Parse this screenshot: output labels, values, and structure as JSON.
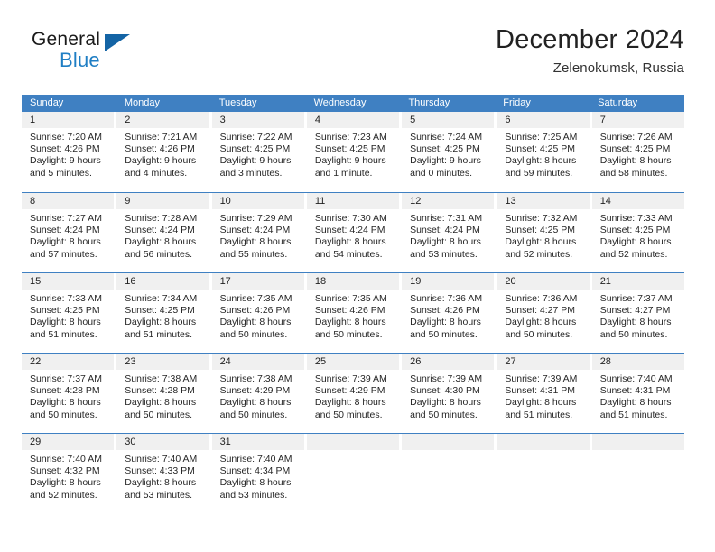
{
  "brand": {
    "name_part1": "General",
    "name_part2": "Blue",
    "triangle_icon": "triangle-icon",
    "accent_blue": "#1f7ec4",
    "logo_blue": "#1464a5"
  },
  "header": {
    "title": "December 2024",
    "subtitle": "Zelenokumsk, Russia"
  },
  "theme": {
    "header_row_bg": "#3f80c2",
    "day_number_bg": "#f0f0f0",
    "week_border": "#3f80c2",
    "text": "#262626"
  },
  "weekday_headers": [
    "Sunday",
    "Monday",
    "Tuesday",
    "Wednesday",
    "Thursday",
    "Friday",
    "Saturday"
  ],
  "weeks": [
    [
      {
        "day": "1",
        "sunrise": "Sunrise: 7:20 AM",
        "sunset": "Sunset: 4:26 PM",
        "daylight_line1": "Daylight: 9 hours",
        "daylight_line2": "and 5 minutes."
      },
      {
        "day": "2",
        "sunrise": "Sunrise: 7:21 AM",
        "sunset": "Sunset: 4:26 PM",
        "daylight_line1": "Daylight: 9 hours",
        "daylight_line2": "and 4 minutes."
      },
      {
        "day": "3",
        "sunrise": "Sunrise: 7:22 AM",
        "sunset": "Sunset: 4:25 PM",
        "daylight_line1": "Daylight: 9 hours",
        "daylight_line2": "and 3 minutes."
      },
      {
        "day": "4",
        "sunrise": "Sunrise: 7:23 AM",
        "sunset": "Sunset: 4:25 PM",
        "daylight_line1": "Daylight: 9 hours",
        "daylight_line2": "and 1 minute."
      },
      {
        "day": "5",
        "sunrise": "Sunrise: 7:24 AM",
        "sunset": "Sunset: 4:25 PM",
        "daylight_line1": "Daylight: 9 hours",
        "daylight_line2": "and 0 minutes."
      },
      {
        "day": "6",
        "sunrise": "Sunrise: 7:25 AM",
        "sunset": "Sunset: 4:25 PM",
        "daylight_line1": "Daylight: 8 hours",
        "daylight_line2": "and 59 minutes."
      },
      {
        "day": "7",
        "sunrise": "Sunrise: 7:26 AM",
        "sunset": "Sunset: 4:25 PM",
        "daylight_line1": "Daylight: 8 hours",
        "daylight_line2": "and 58 minutes."
      }
    ],
    [
      {
        "day": "8",
        "sunrise": "Sunrise: 7:27 AM",
        "sunset": "Sunset: 4:24 PM",
        "daylight_line1": "Daylight: 8 hours",
        "daylight_line2": "and 57 minutes."
      },
      {
        "day": "9",
        "sunrise": "Sunrise: 7:28 AM",
        "sunset": "Sunset: 4:24 PM",
        "daylight_line1": "Daylight: 8 hours",
        "daylight_line2": "and 56 minutes."
      },
      {
        "day": "10",
        "sunrise": "Sunrise: 7:29 AM",
        "sunset": "Sunset: 4:24 PM",
        "daylight_line1": "Daylight: 8 hours",
        "daylight_line2": "and 55 minutes."
      },
      {
        "day": "11",
        "sunrise": "Sunrise: 7:30 AM",
        "sunset": "Sunset: 4:24 PM",
        "daylight_line1": "Daylight: 8 hours",
        "daylight_line2": "and 54 minutes."
      },
      {
        "day": "12",
        "sunrise": "Sunrise: 7:31 AM",
        "sunset": "Sunset: 4:24 PM",
        "daylight_line1": "Daylight: 8 hours",
        "daylight_line2": "and 53 minutes."
      },
      {
        "day": "13",
        "sunrise": "Sunrise: 7:32 AM",
        "sunset": "Sunset: 4:25 PM",
        "daylight_line1": "Daylight: 8 hours",
        "daylight_line2": "and 52 minutes."
      },
      {
        "day": "14",
        "sunrise": "Sunrise: 7:33 AM",
        "sunset": "Sunset: 4:25 PM",
        "daylight_line1": "Daylight: 8 hours",
        "daylight_line2": "and 52 minutes."
      }
    ],
    [
      {
        "day": "15",
        "sunrise": "Sunrise: 7:33 AM",
        "sunset": "Sunset: 4:25 PM",
        "daylight_line1": "Daylight: 8 hours",
        "daylight_line2": "and 51 minutes."
      },
      {
        "day": "16",
        "sunrise": "Sunrise: 7:34 AM",
        "sunset": "Sunset: 4:25 PM",
        "daylight_line1": "Daylight: 8 hours",
        "daylight_line2": "and 51 minutes."
      },
      {
        "day": "17",
        "sunrise": "Sunrise: 7:35 AM",
        "sunset": "Sunset: 4:26 PM",
        "daylight_line1": "Daylight: 8 hours",
        "daylight_line2": "and 50 minutes."
      },
      {
        "day": "18",
        "sunrise": "Sunrise: 7:35 AM",
        "sunset": "Sunset: 4:26 PM",
        "daylight_line1": "Daylight: 8 hours",
        "daylight_line2": "and 50 minutes."
      },
      {
        "day": "19",
        "sunrise": "Sunrise: 7:36 AM",
        "sunset": "Sunset: 4:26 PM",
        "daylight_line1": "Daylight: 8 hours",
        "daylight_line2": "and 50 minutes."
      },
      {
        "day": "20",
        "sunrise": "Sunrise: 7:36 AM",
        "sunset": "Sunset: 4:27 PM",
        "daylight_line1": "Daylight: 8 hours",
        "daylight_line2": "and 50 minutes."
      },
      {
        "day": "21",
        "sunrise": "Sunrise: 7:37 AM",
        "sunset": "Sunset: 4:27 PM",
        "daylight_line1": "Daylight: 8 hours",
        "daylight_line2": "and 50 minutes."
      }
    ],
    [
      {
        "day": "22",
        "sunrise": "Sunrise: 7:37 AM",
        "sunset": "Sunset: 4:28 PM",
        "daylight_line1": "Daylight: 8 hours",
        "daylight_line2": "and 50 minutes."
      },
      {
        "day": "23",
        "sunrise": "Sunrise: 7:38 AM",
        "sunset": "Sunset: 4:28 PM",
        "daylight_line1": "Daylight: 8 hours",
        "daylight_line2": "and 50 minutes."
      },
      {
        "day": "24",
        "sunrise": "Sunrise: 7:38 AM",
        "sunset": "Sunset: 4:29 PM",
        "daylight_line1": "Daylight: 8 hours",
        "daylight_line2": "and 50 minutes."
      },
      {
        "day": "25",
        "sunrise": "Sunrise: 7:39 AM",
        "sunset": "Sunset: 4:29 PM",
        "daylight_line1": "Daylight: 8 hours",
        "daylight_line2": "and 50 minutes."
      },
      {
        "day": "26",
        "sunrise": "Sunrise: 7:39 AM",
        "sunset": "Sunset: 4:30 PM",
        "daylight_line1": "Daylight: 8 hours",
        "daylight_line2": "and 50 minutes."
      },
      {
        "day": "27",
        "sunrise": "Sunrise: 7:39 AM",
        "sunset": "Sunset: 4:31 PM",
        "daylight_line1": "Daylight: 8 hours",
        "daylight_line2": "and 51 minutes."
      },
      {
        "day": "28",
        "sunrise": "Sunrise: 7:40 AM",
        "sunset": "Sunset: 4:31 PM",
        "daylight_line1": "Daylight: 8 hours",
        "daylight_line2": "and 51 minutes."
      }
    ],
    [
      {
        "day": "29",
        "sunrise": "Sunrise: 7:40 AM",
        "sunset": "Sunset: 4:32 PM",
        "daylight_line1": "Daylight: 8 hours",
        "daylight_line2": "and 52 minutes."
      },
      {
        "day": "30",
        "sunrise": "Sunrise: 7:40 AM",
        "sunset": "Sunset: 4:33 PM",
        "daylight_line1": "Daylight: 8 hours",
        "daylight_line2": "and 53 minutes."
      },
      {
        "day": "31",
        "sunrise": "Sunrise: 7:40 AM",
        "sunset": "Sunset: 4:34 PM",
        "daylight_line1": "Daylight: 8 hours",
        "daylight_line2": "and 53 minutes."
      },
      {
        "day": "",
        "sunrise": "",
        "sunset": "",
        "daylight_line1": "",
        "daylight_line2": ""
      },
      {
        "day": "",
        "sunrise": "",
        "sunset": "",
        "daylight_line1": "",
        "daylight_line2": ""
      },
      {
        "day": "",
        "sunrise": "",
        "sunset": "",
        "daylight_line1": "",
        "daylight_line2": ""
      },
      {
        "day": "",
        "sunrise": "",
        "sunset": "",
        "daylight_line1": "",
        "daylight_line2": ""
      }
    ]
  ]
}
